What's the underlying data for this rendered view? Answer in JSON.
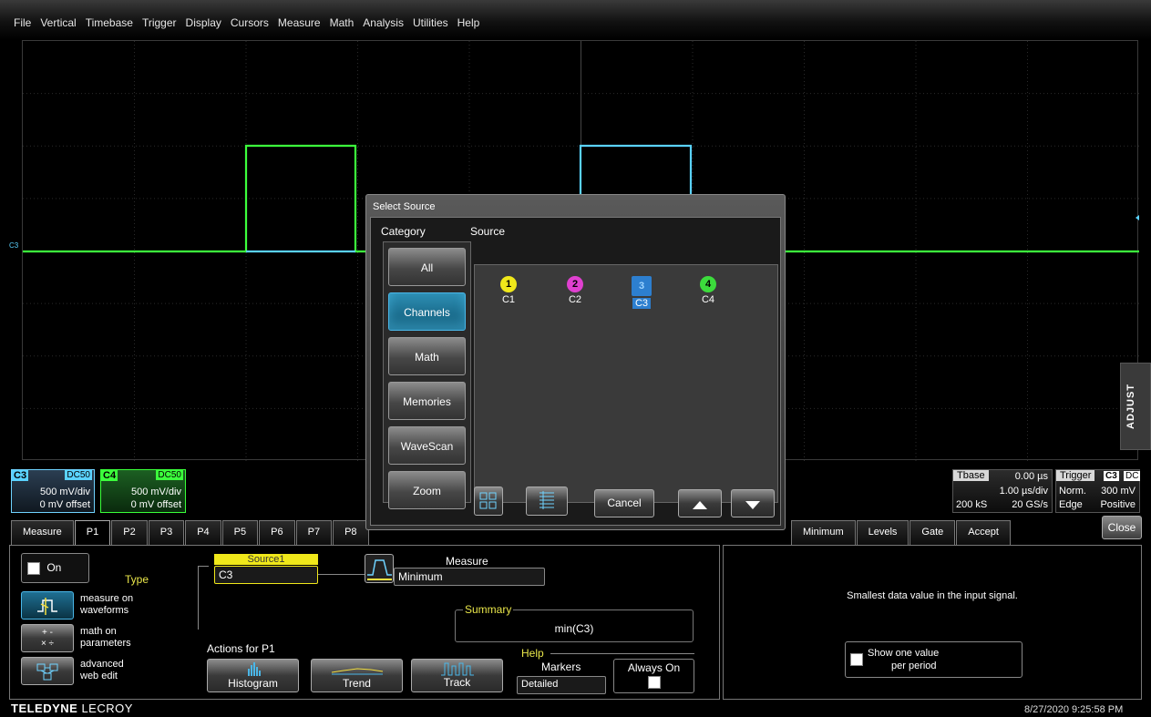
{
  "menu": [
    "File",
    "Vertical",
    "Timebase",
    "Trigger",
    "Display",
    "Cursors",
    "Measure",
    "Math",
    "Analysis",
    "Utilities",
    "Help"
  ],
  "grid_label": "C3",
  "adjust_label": "ADJUST",
  "channels": {
    "c3": {
      "tag": "C3",
      "coupling": "DC50",
      "vdiv": "500 mV/div",
      "offset": "0 mV offset",
      "color": "#5ad2ff"
    },
    "c4": {
      "tag": "C4",
      "coupling": "DC50",
      "vdiv": "500 mV/div",
      "offset": "0 mV offset",
      "color": "#3cff3c"
    }
  },
  "timebase": {
    "header": "Tbase",
    "delay": "0.00 µs",
    "tdiv": "1.00 µs/div",
    "samples": "200 kS",
    "rate": "20 GS/s"
  },
  "trigger": {
    "header": "Trigger",
    "source_badge": "C3",
    "coupling_badge": "DC",
    "mode": "Norm.",
    "level": "300 mV",
    "type": "Edge",
    "slope": "Positive"
  },
  "tabs": [
    "Measure",
    "P1",
    "P2",
    "P3",
    "P4",
    "P5",
    "P6",
    "P7",
    "P8"
  ],
  "right_tabs": [
    "Minimum",
    "Levels",
    "Gate",
    "Accept"
  ],
  "close_label": "Close",
  "p1": {
    "on_label": "On",
    "type_label": "Type",
    "type_options": [
      {
        "label": "measure on waveforms",
        "line1": "measure on",
        "line2": "waveforms"
      },
      {
        "label": "math on parameters",
        "line1": "math on",
        "line2": "parameters"
      },
      {
        "label": "advanced web edit",
        "line1": "advanced",
        "line2": "web edit"
      }
    ],
    "source1_label": "Source1",
    "source1_value": "C3",
    "measure_label": "Measure",
    "measure_value": "Minimum",
    "summary_label": "Summary",
    "summary_value": "min(C3)",
    "actions_label": "Actions for P1",
    "actions": [
      "Histogram",
      "Trend",
      "Track"
    ],
    "help_label": "Help",
    "markers_label": "Markers",
    "markers_value": "Detailed",
    "always_on_label": "Always On"
  },
  "right_panel": {
    "description": "Smallest data value in the input signal.",
    "show_one_line1": "Show one value",
    "show_one_line2": "per period"
  },
  "dialog": {
    "title": "Select Source",
    "category_label": "Category",
    "source_label": "Source",
    "categories": [
      "All",
      "Channels",
      "Math",
      "Memories",
      "WaveScan",
      "Zoom"
    ],
    "selected_category": "Channels",
    "sources": [
      {
        "num": "1",
        "label": "C1",
        "color": "#f0e81a"
      },
      {
        "num": "2",
        "label": "C2",
        "color": "#e040d0"
      },
      {
        "num": "3",
        "label": "C3",
        "color": "#2d7fcf"
      },
      {
        "num": "4",
        "label": "C4",
        "color": "#3cdc3c"
      }
    ],
    "selected_source": "C3",
    "cancel_label": "Cancel"
  },
  "footer": {
    "brand_bold": "TELEDYNE",
    "brand_thin": " LECROY",
    "datetime": "8/27/2020 9:25:58 PM"
  }
}
